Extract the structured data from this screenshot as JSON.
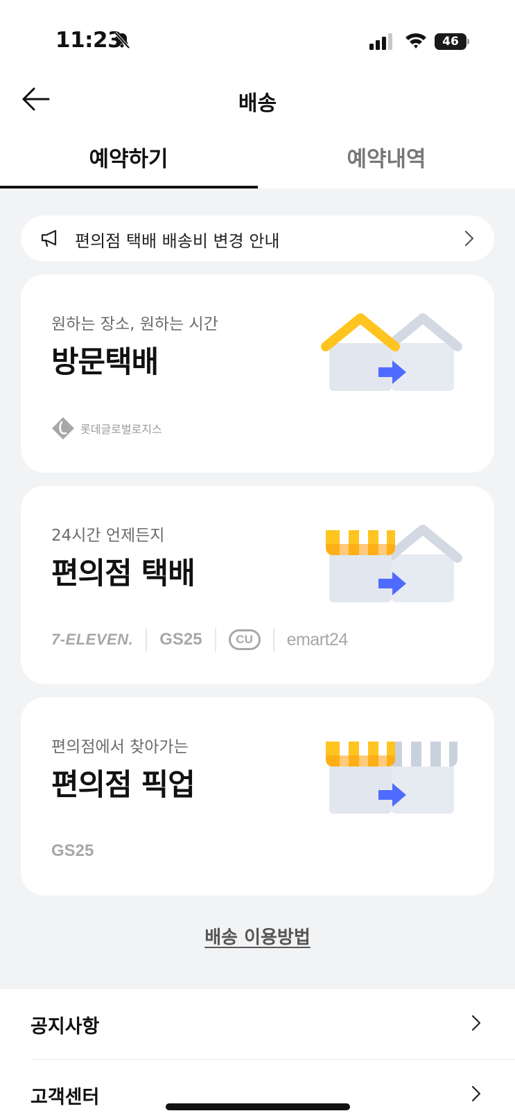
{
  "status_bar": {
    "time": "11:23",
    "battery": "46"
  },
  "header": {
    "title": "배송"
  },
  "tabs": [
    {
      "label": "예약하기",
      "active": true
    },
    {
      "label": "예약내역",
      "active": false
    }
  ],
  "notice": {
    "text": "편의점 택배 배송비 변경 안내"
  },
  "cards": [
    {
      "subtitle": "원하는 장소, 원하는 시간",
      "title": "방문택배",
      "partner_text": "롯데글로벌로지스"
    },
    {
      "subtitle": "24시간 언제든지",
      "title": "편의점 택배",
      "brands": [
        "7-ELEVEN.",
        "GS25",
        "CU",
        "emart24"
      ]
    },
    {
      "subtitle": "편의점에서 찾아가는",
      "title": "편의점 픽업",
      "brands": [
        "GS25"
      ]
    }
  ],
  "howto_link": "배송 이용방법",
  "menu": [
    {
      "label": "공지사항"
    },
    {
      "label": "고객센터"
    }
  ],
  "colors": {
    "background": "#f2f3f5",
    "accent_yellow": "#ffc41f",
    "accent_orange": "#ff9f0f",
    "arrow_blue": "#4f6bff",
    "roof_gray": "#d3d9e3",
    "logo_gray": "#a7a7a7"
  },
  "icons": {
    "back": "arrow-left-icon",
    "notice": "megaphone-icon",
    "chevron": "chevron-right-icon",
    "mute": "bell-slash-icon"
  }
}
